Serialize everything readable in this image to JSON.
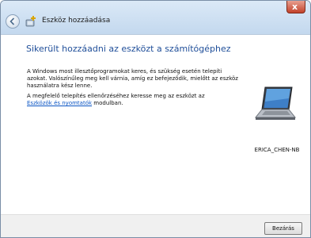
{
  "window": {
    "title": "Eszköz hozzáadása",
    "close_glyph": "x"
  },
  "content": {
    "heading": "Sikerült hozzáadni az eszközt a számítógéphez",
    "paragraph1": "A Windows most illesztőprogramokat keres, és szükség esetén telepíti azokat. Valószínűleg meg kell várnia, amíg ez befejeződik, mielőtt az eszköz használatra kész lenne.",
    "paragraph2_prefix": "A megfelelő telepítés ellenőrzéséhez keresse meg az eszközt az",
    "paragraph2_link": "Eszközök és nyomtatók",
    "paragraph2_suffix": "modulban."
  },
  "device": {
    "name": "ERICA_CHEN-NB",
    "icon": "laptop-icon"
  },
  "footer": {
    "close_label": "Bezárás"
  },
  "colors": {
    "heading": "#1f4e99",
    "link": "#0b55c4",
    "titlebar": "#c3d8ee",
    "close_button": "#c2412a"
  }
}
